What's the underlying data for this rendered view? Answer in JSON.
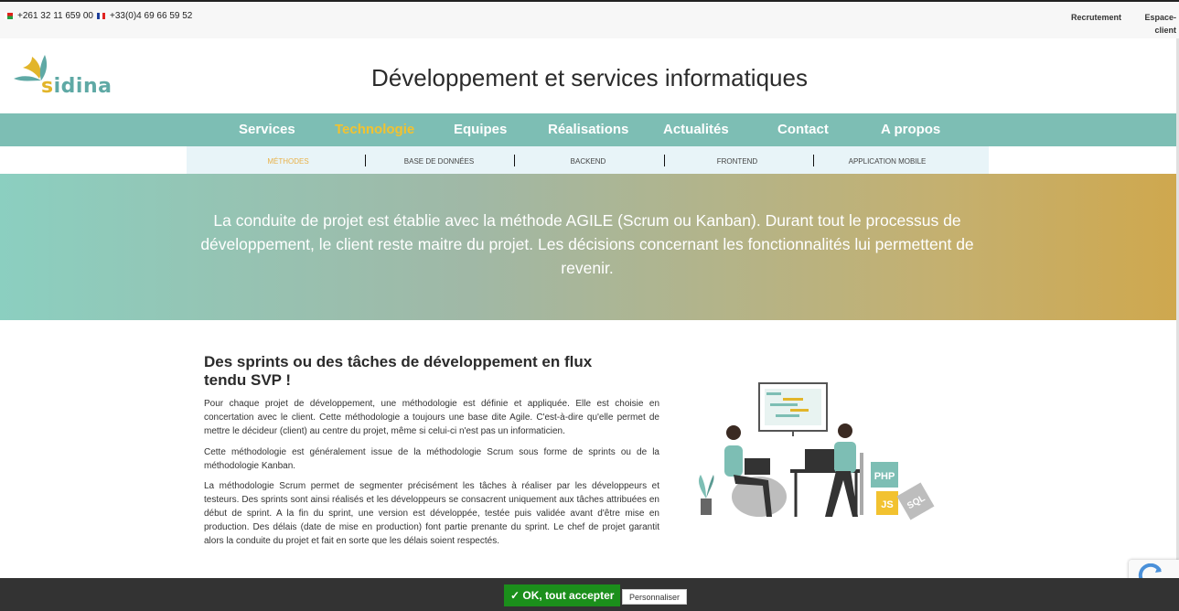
{
  "topbar": {
    "phone_mg": "+261 32 11 659 00",
    "phone_fr": "+33(0)4 69 66 59 52",
    "recrutement": "Recrutement",
    "espace_client_1": "Espace-",
    "espace_client_2": "client"
  },
  "logo": {
    "text_s": "s",
    "text_rest": "idina"
  },
  "site_title": "Développement et services informatiques",
  "nav": {
    "services": "Services",
    "technologie": "Technologie",
    "equipes": "Equipes",
    "realisations": "Réalisations",
    "actualites": "Actualités",
    "contact": "Contact",
    "apropos": "A propos"
  },
  "subnav": {
    "methodes": "Méthodes",
    "base_donnees": "Base de données",
    "backend": "Backend",
    "frontend": "Frontend",
    "mobile": "Application mobile"
  },
  "banner": {
    "text": "La conduite de projet est établie avec la méthode AGILE (Scrum ou Kanban). Durant tout le processus de développement, le client reste maitre du projet. Les décisions concernant les fonctionnalités lui permettent de revenir."
  },
  "content": {
    "title": "Des sprints ou des tâches de développement en flux tendu SVP !",
    "p1": "Pour chaque projet de développement, une méthodologie est définie et appliquée. Elle est choisie en concertation avec le client. Cette méthodologie a toujours une base dite Agile. C'est-à-dire qu'elle permet de mettre le décideur (client) au centre du projet, même si celui-ci n'est pas un informaticien.",
    "p2": "Cette méthodologie est généralement issue de la méthodologie Scrum sous forme de sprints ou de la méthodologie Kanban.",
    "p3": "La méthodologie Scrum permet de segmenter précisément les tâches à réaliser par les développeurs et testeurs. Des sprints sont ainsi réalisés et les développeurs se consacrent uniquement aux tâches attribuées en début de sprint. A la fin du sprint, une version est développée, testée puis validée avant d'être mise en production. Des délais (date de mise en production) font partie prenante du sprint. Le chef de projet garantit alors la conduite du projet et fait en sorte que les délais soient respectés."
  },
  "illustration": {
    "php": "PHP",
    "js": "JS",
    "sql": "SQL"
  },
  "cookie": {
    "accept": "✓ OK, tout accepter",
    "customize": "Personnaliser"
  },
  "colors": {
    "nav_bg": "#7dbeb4",
    "nav_active": "#f2c230",
    "accept_green": "#1b8f1b"
  }
}
